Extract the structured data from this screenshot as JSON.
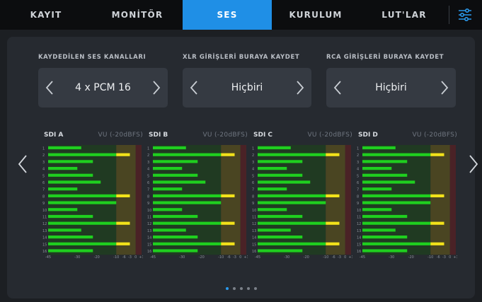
{
  "tabs": [
    {
      "label": "KAYIT",
      "active": false
    },
    {
      "label": "MONİTÖR",
      "active": false
    },
    {
      "label": "SES",
      "active": true
    },
    {
      "label": "KURULUM",
      "active": false
    },
    {
      "label": "LUT'LAR",
      "active": false
    }
  ],
  "menu_icon": "sliders-icon",
  "settings": {
    "audio_channels": {
      "label": "KAYDEDİLEN SES KANALLARI",
      "value": "4 x PCM 16"
    },
    "xlr_inputs": {
      "label": "XLR GİRİŞLERİ BURAYA KAYDET",
      "value": "Hiçbiri"
    },
    "rca_inputs": {
      "label": "RCA GİRİŞLERİ BURAYA KAYDET",
      "value": "Hiçbiri"
    }
  },
  "meters": {
    "scale_label": "VU (-20dBFS)",
    "scale_ticks": [
      "-45",
      "-30",
      "-20",
      "-10",
      "-6",
      "-3",
      "0",
      "+3"
    ],
    "channel_numbers": [
      "1",
      "2",
      "3",
      "4",
      "5",
      "6",
      "7",
      "8",
      "9",
      "10",
      "11",
      "12",
      "13",
      "14",
      "15",
      "16"
    ],
    "peak_db": [
      -28,
      -3,
      -22,
      -30,
      -22,
      -18,
      -30,
      -3,
      -10,
      -30,
      -22,
      -3,
      -28,
      -22,
      -3,
      -22
    ],
    "groups": [
      {
        "name": "SDI A"
      },
      {
        "name": "SDI B"
      },
      {
        "name": "SDI C"
      },
      {
        "name": "SDI D"
      }
    ]
  },
  "pagination": {
    "count": 5,
    "active_index": 0
  },
  "colors": {
    "accent": "#1f8fe6",
    "meter_green": "#1fcf1f",
    "meter_yellow": "#f2e21a",
    "peak_hold": "#f4e81b"
  }
}
